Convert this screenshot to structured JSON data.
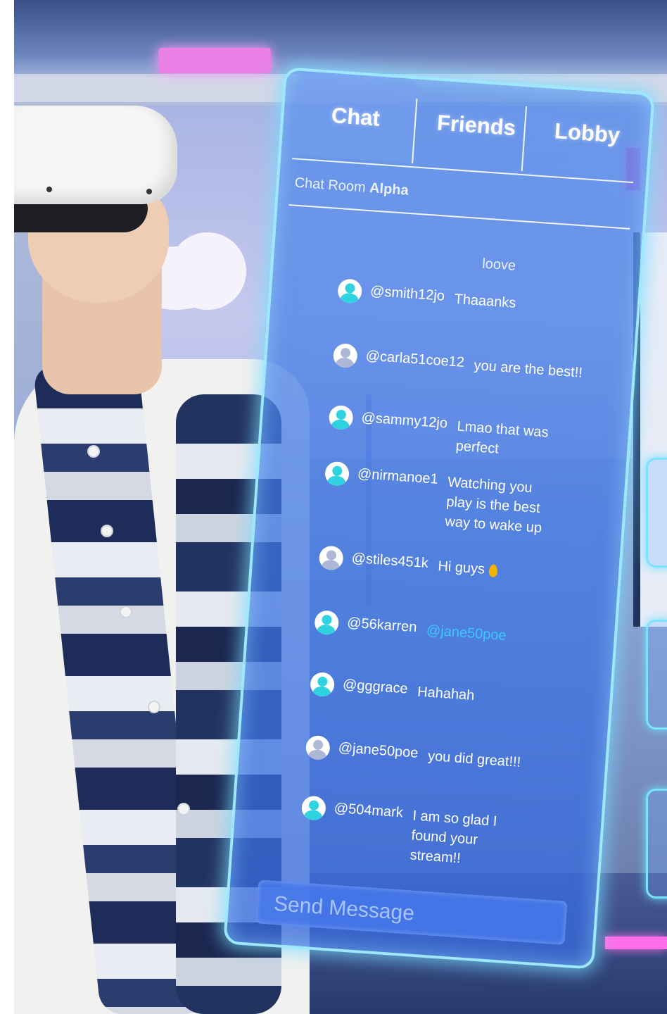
{
  "tabs": [
    {
      "label": "Chat",
      "active": true
    },
    {
      "label": "Friends",
      "active": false
    },
    {
      "label": "Lobby",
      "active": false
    }
  ],
  "room": {
    "prefix": "Chat Room",
    "name": "Alpha"
  },
  "first_message": "loove",
  "messages": [
    {
      "user": "@smith12jo",
      "text": "Thaaanks",
      "avatar_color": "#2fd3df"
    },
    {
      "user": "@carla51coe12",
      "text": "you are the best!!",
      "avatar_color": "#aeb8d6"
    },
    {
      "user": "@sammy12jo",
      "text": "Lmao that was perfect",
      "avatar_color": "#2fd3df"
    },
    {
      "user": "@nirmanoe1",
      "text": "Watching you play is the best way to wake up",
      "avatar_color": "#2fd3df"
    },
    {
      "user": "@stiles451k",
      "text": "Hi guys",
      "avatar_color": "#aeb8d6",
      "emoji": "droplet-icon"
    },
    {
      "user": "@56karren",
      "text": "@jane50poe",
      "avatar_color": "#2fd3df",
      "mention": true
    },
    {
      "user": "@gggrace",
      "text": "Hahahah",
      "avatar_color": "#2fd3df"
    },
    {
      "user": "@jane50poe",
      "text": "you did great!!!",
      "avatar_color": "#aeb8d6"
    },
    {
      "user": "@504mark",
      "text": "I am so glad I found your stream!!",
      "avatar_color": "#2fd3df"
    }
  ],
  "composer": {
    "placeholder": "Send Message"
  },
  "colors": {
    "panel_border": "#9ce8ff",
    "mention": "#3ec6ff",
    "neon": "#e880e6"
  }
}
